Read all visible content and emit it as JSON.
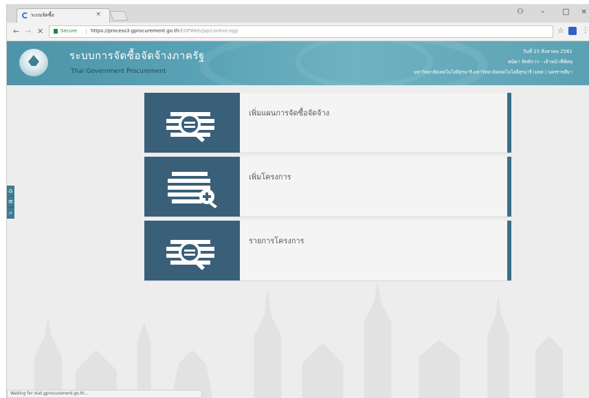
{
  "browser": {
    "tab_title": "ระบบจัดซื้อ",
    "tab_close": "×",
    "window_controls": {
      "account": "⚇",
      "minimize": "–",
      "maximize": "□",
      "close": "×"
    },
    "nav": {
      "back": "←",
      "forward": "→",
      "reload": "✕"
    },
    "security_label": "Secure",
    "url_host": "https://process3.gprocurement.go.th",
    "url_path": "/EGPWeb/jsp/control.egp",
    "star": "☆",
    "menu": "⋮",
    "status_text": "Waiting for stat.gprocurement.go.th..."
  },
  "header": {
    "title": "ระบบการจัดซื้อจัดจ้างภาครัฐ",
    "subtitle": "Thai Government Procurement",
    "date": "วันที่ 15 สิงหาคม 2561",
    "user": "พนิดา สิทธิการ - เจ้าหน้าที่พัสดุ",
    "organization": "มหาวิทยาลัยเทคโนโลยีสุรนารี-มหาวิทยาลัยเทคโนโลยีสุรนารี (มทส.) นครราชสีมา"
  },
  "side_toolbar": [
    {
      "icon": "home-icon",
      "glyph": "⌂"
    },
    {
      "icon": "menu-icon",
      "glyph": "≡"
    },
    {
      "icon": "search-icon",
      "glyph": "⌕"
    }
  ],
  "menu_cards": [
    {
      "label": "เพิ่มแผนการจัดซื้อจัดจ้าง",
      "icon": "plan-search-icon"
    },
    {
      "label": "เพิ่มโครงการ",
      "icon": "add-project-icon"
    },
    {
      "label": "รายการโครงการ",
      "icon": "project-list-icon"
    }
  ],
  "colors": {
    "header": "#5aa3b6",
    "card_icon_bg": "#3a5f78",
    "card_accent": "#3e6e86",
    "content_bg": "#ededed"
  }
}
